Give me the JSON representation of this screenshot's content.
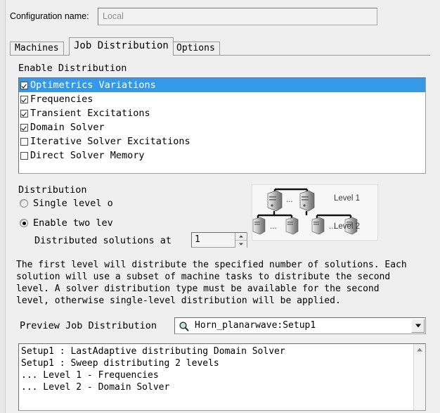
{
  "config": {
    "label": "Configuration name:",
    "value": "Local"
  },
  "tabs": [
    {
      "label": "Machines",
      "active": false
    },
    {
      "label": "Job Distribution",
      "active": true
    },
    {
      "label": "Options",
      "active": false
    }
  ],
  "enable_distribution": {
    "group_label": "Enable Distribution",
    "items": [
      {
        "label": "Optimetrics Variations",
        "checked": true,
        "selected": true
      },
      {
        "label": "Frequencies",
        "checked": true,
        "selected": false
      },
      {
        "label": "Transient Excitations",
        "checked": true,
        "selected": false
      },
      {
        "label": "Domain Solver",
        "checked": true,
        "selected": false
      },
      {
        "label": "Iterative Solver Excitations",
        "checked": false,
        "selected": false
      },
      {
        "label": "Direct Solver Memory",
        "checked": false,
        "selected": false
      }
    ]
  },
  "distribution": {
    "group_label": "Distribution",
    "radio_single": "Single level o",
    "radio_two": "Enable two lev",
    "selected_radio": "two",
    "solutions_label": "Distributed solutions at",
    "solutions_value": "1",
    "diagram": {
      "level1": "Level 1",
      "level2": "Level 2",
      "ellipsis": "..."
    },
    "description": "The first level will distribute the specified number of solutions. Each\nsolution will use a subset of machine tasks to distribute the second\nlevel. A solver distribution type must be available for the second\nlevel, otherwise single-level distribution will be applied."
  },
  "preview": {
    "label": "Preview Job Distribution",
    "combo_value": "Horn_planarwave:Setup1",
    "log": "Setup1 : LastAdaptive distributing Domain Solver\nSetup1 : Sweep distributing 2 levels\n... Level 1 - Frequencies\n... Level 2 - Domain Solver"
  },
  "colors": {
    "selection_blue": "#3399e8",
    "background": "#efefef"
  }
}
